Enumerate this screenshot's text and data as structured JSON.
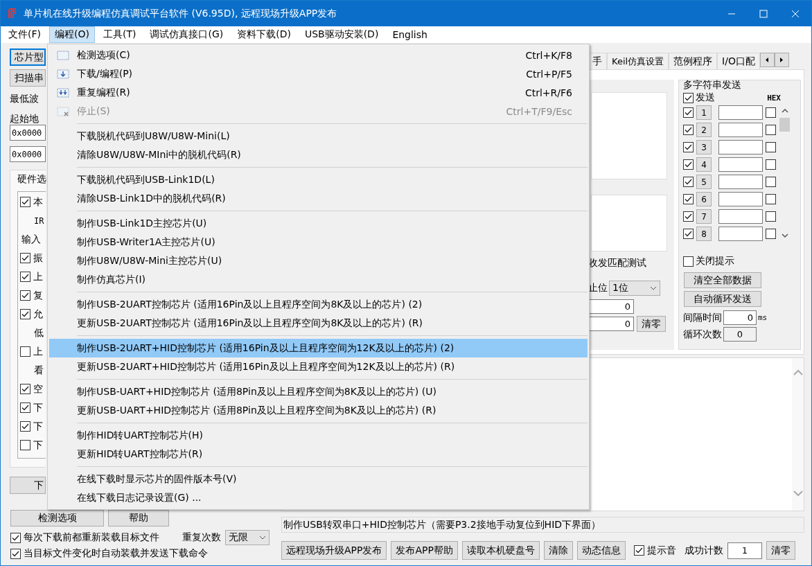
{
  "window": {
    "title": "单片机在线升级编程仿真调试平台软件 (V6.95D), 远程现场升级APP发布"
  },
  "menu_bar": [
    {
      "label": "文件(F)",
      "selected": false
    },
    {
      "label": "编程(O)",
      "selected": true
    },
    {
      "label": "工具(T)",
      "selected": false
    },
    {
      "label": "调试仿真接口(G)",
      "selected": false
    },
    {
      "label": "资料下载(D)",
      "selected": false
    },
    {
      "label": "USB驱动安装(D)",
      "selected": false
    },
    {
      "label": "English",
      "selected": false
    }
  ],
  "left_panel": {
    "top_buttons": [
      {
        "label": "芯片型",
        "focused": true
      },
      {
        "label": "扫描串",
        "focused": false
      }
    ],
    "baud_label": "最低波",
    "address_label": "起始地",
    "address_fields": [
      "0x0000",
      "0x0000"
    ],
    "hardware_tab": "硬件选",
    "options": [
      {
        "kind": "checkbox",
        "label": "本",
        "checked": true
      },
      {
        "kind": "text",
        "label": "IR"
      },
      {
        "kind": "heading",
        "label": "输入"
      },
      {
        "kind": "checkbox",
        "label": "振",
        "checked": true
      },
      {
        "kind": "checkbox",
        "label": "上",
        "checked": true
      },
      {
        "kind": "checkbox",
        "label": "复",
        "checked": true
      },
      {
        "kind": "checkbox",
        "label": "允",
        "checked": true
      },
      {
        "kind": "text",
        "label": "低"
      },
      {
        "kind": "checkbox",
        "label": "上",
        "checked": false
      },
      {
        "kind": "text",
        "label": "看"
      },
      {
        "kind": "checkbox",
        "label": "空",
        "checked": true
      },
      {
        "kind": "checkbox",
        "label": "下",
        "checked": true
      },
      {
        "kind": "checkbox",
        "label": "下",
        "checked": true
      },
      {
        "kind": "checkbox",
        "label": "下",
        "checked": false
      }
    ],
    "download_button": "下",
    "check_button": "检测选项",
    "help_button": "帮助",
    "repeat": {
      "label": "重复次数",
      "value": "无限"
    },
    "checkboxes": [
      {
        "label": "每次下载前都重新装载目标文件",
        "checked": true
      },
      {
        "label": "当目标文件变化时自动装载并发送下载命令",
        "checked": true
      }
    ]
  },
  "right_panel": {
    "tabs": [
      {
        "label": "手",
        "selected": false
      },
      {
        "label": "Keil仿真设置",
        "selected": false
      },
      {
        "label": "范例程序",
        "selected": false
      },
      {
        "label": "I/O口配",
        "selected": false
      }
    ],
    "match_test_label": "收发匹配测试",
    "stop_bits_label": "止位",
    "stop_bits_value": "1位",
    "counters": [
      "0",
      "0"
    ],
    "clear_button": "清零",
    "multi_send": {
      "title": "多字符串发送",
      "send_all": {
        "label": "发送",
        "checked": true
      },
      "hex_label": "HEX",
      "rows": [
        {
          "number": "1",
          "checked": true,
          "hex": false
        },
        {
          "number": "2",
          "checked": true,
          "hex": false
        },
        {
          "number": "3",
          "checked": true,
          "hex": false
        },
        {
          "number": "4",
          "checked": true,
          "hex": false
        },
        {
          "number": "5",
          "checked": true,
          "hex": false
        },
        {
          "number": "6",
          "checked": true,
          "hex": false
        },
        {
          "number": "7",
          "checked": true,
          "hex": false
        },
        {
          "number": "8",
          "checked": true,
          "hex": false
        }
      ],
      "close_hint": {
        "label": "关闭提示",
        "checked": false
      },
      "buttons": [
        "清空全部数据",
        "自动循环发送"
      ],
      "interval": {
        "label": "间隔时间",
        "value": "0",
        "unit": "ms"
      },
      "loop_count": {
        "label": "循环次数",
        "value": "0"
      }
    }
  },
  "status_text": "制作USB转双串口+HID控制芯片（需要P3.2接地手动复位到HID下界面）",
  "bottom_bar": {
    "buttons": [
      "远程现场升级APP发布",
      "发布APP帮助",
      "读取本机硬盘号",
      "清除",
      "动态信息"
    ],
    "sound": {
      "label": "提示音",
      "checked": true
    },
    "success_label": "成功计数",
    "success_count": "1",
    "reset_button": "清零"
  },
  "dropdown": {
    "items": [
      {
        "kind": "icon_item",
        "label": "检测选项(C)",
        "shortcut": "Ctrl+K/F8",
        "disabled": false,
        "selected": false
      },
      {
        "kind": "icon_item",
        "label": "下载/编程(P)",
        "shortcut": "Ctrl+P/F5",
        "disabled": false,
        "selected": false
      },
      {
        "kind": "icon_item",
        "label": "重复编程(R)",
        "shortcut": "Ctrl+R/F6",
        "disabled": false,
        "selected": false
      },
      {
        "kind": "icon_item",
        "label": "停止(S)",
        "shortcut": "Ctrl+T/F9/Esc",
        "disabled": true,
        "selected": false
      },
      {
        "kind": "separator"
      },
      {
        "kind": "item",
        "label": "下载脱机代码到U8W/U8W-Mini(L)",
        "disabled": false,
        "selected": false
      },
      {
        "kind": "item",
        "label": "清除U8W/U8W-MIni中的脱机代码(R)",
        "disabled": false,
        "selected": false
      },
      {
        "kind": "separator"
      },
      {
        "kind": "item",
        "label": "下载脱机代码到USB-Link1D(L)",
        "disabled": false,
        "selected": false
      },
      {
        "kind": "item",
        "label": "清除USB-Link1D中的脱机代码(R)",
        "disabled": false,
        "selected": false
      },
      {
        "kind": "separator"
      },
      {
        "kind": "item",
        "label": "制作USB-Link1D主控芯片(U)",
        "disabled": false,
        "selected": false
      },
      {
        "kind": "item",
        "label": "制作USB-Writer1A主控芯片(U)",
        "disabled": false,
        "selected": false
      },
      {
        "kind": "item",
        "label": "制作U8W/U8W-Mini主控芯片(U)",
        "disabled": false,
        "selected": false
      },
      {
        "kind": "item",
        "label": "制作仿真芯片(I)",
        "disabled": false,
        "selected": false
      },
      {
        "kind": "separator"
      },
      {
        "kind": "item",
        "label": "制作USB-2UART控制芯片 (适用16Pin及以上且程序空间为8K及以上的芯片) (2)",
        "disabled": false,
        "selected": false
      },
      {
        "kind": "item",
        "label": "更新USB-2UART控制芯片 (适用16Pin及以上且程序空间为8K及以上的芯片) (R)",
        "disabled": false,
        "selected": false
      },
      {
        "kind": "separator"
      },
      {
        "kind": "item",
        "label": "制作USB-2UART+HID控制芯片 (适用16Pin及以上且程序空间为12K及以上的芯片) (2)",
        "disabled": false,
        "selected": true
      },
      {
        "kind": "item",
        "label": "更新USB-2UART+HID控制芯片 (适用16Pin及以上且程序空间为12K及以上的芯片) (R)",
        "disabled": false,
        "selected": false
      },
      {
        "kind": "separator"
      },
      {
        "kind": "item",
        "label": "制作USB-UART+HID控制芯片 (适用8Pin及以上且程序空间为8K及以上的芯片) (U)",
        "disabled": false,
        "selected": false
      },
      {
        "kind": "item",
        "label": "更新USB-UART+HID控制芯片 (适用8Pin及以上且程序空间为8K及以上的芯片) (R)",
        "disabled": false,
        "selected": false
      },
      {
        "kind": "separator"
      },
      {
        "kind": "item",
        "label": "制作HID转UART控制芯片(H)",
        "disabled": false,
        "selected": false
      },
      {
        "kind": "item",
        "label": "更新HID转UART控制芯片(R)",
        "disabled": false,
        "selected": false
      },
      {
        "kind": "separator"
      },
      {
        "kind": "item",
        "label": "在线下载时显示芯片的固件版本号(V)",
        "disabled": false,
        "selected": false
      },
      {
        "kind": "item",
        "label": "在线下载日志记录设置(G) ...",
        "disabled": false,
        "selected": false
      }
    ]
  }
}
